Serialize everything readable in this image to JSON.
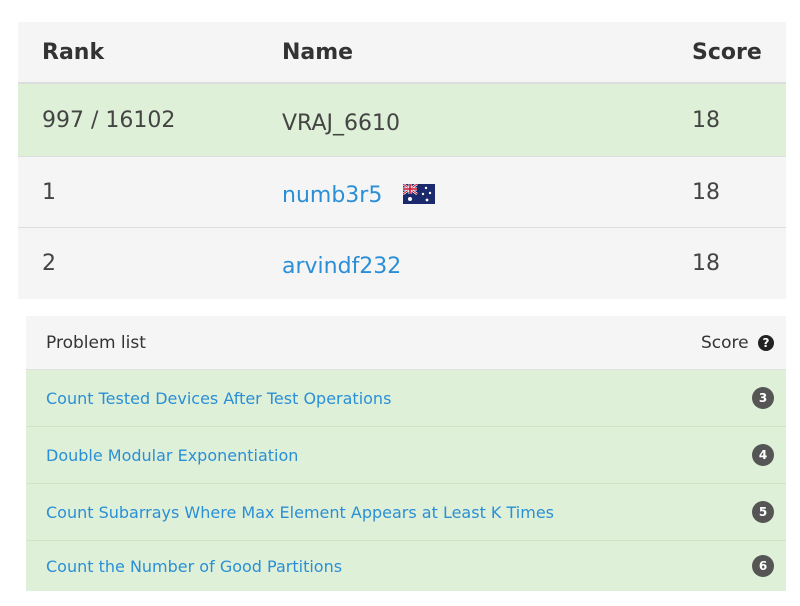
{
  "ranking": {
    "headers": {
      "rank": "Rank",
      "name": "Name",
      "score": "Score"
    },
    "rows": [
      {
        "rank": "997 / 16102",
        "name": "VRAJ_6610",
        "score": "18",
        "highlight": true
      },
      {
        "rank": "1",
        "name": "numb3r5",
        "score": "18",
        "flag": "australia-flag-icon"
      },
      {
        "rank": "2",
        "name": "arvindf232",
        "score": "18"
      }
    ]
  },
  "problems": {
    "header_label": "Problem list",
    "score_label": "Score",
    "help_symbol": "?",
    "items": [
      {
        "title": "Count Tested Devices After Test Operations",
        "score": "3"
      },
      {
        "title": "Double Modular Exponentiation",
        "score": "4"
      },
      {
        "title": "Count Subarrays Where Max Element Appears at Least K Times",
        "score": "5"
      },
      {
        "title": "Count the Number of Good Partitions",
        "score": "6"
      }
    ]
  },
  "colors": {
    "highlight_row": "#dff0d8",
    "link": "#2a8fd6",
    "badge": "#555555"
  }
}
